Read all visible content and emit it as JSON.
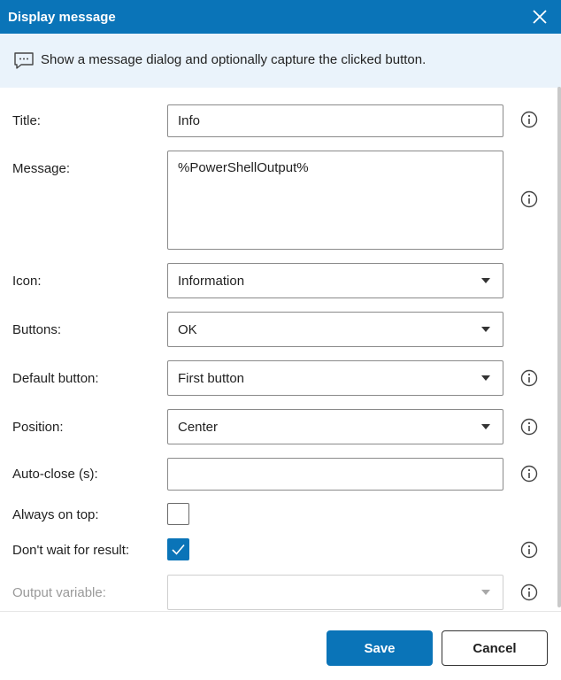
{
  "dialog": {
    "title": "Display message",
    "description": "Show a message dialog and optionally capture the clicked button."
  },
  "fields": {
    "title": {
      "label": "Title:",
      "value": "Info"
    },
    "message": {
      "label": "Message:",
      "value": "%PowerShellOutput%"
    },
    "icon": {
      "label": "Icon:",
      "value": "Information"
    },
    "buttons": {
      "label": "Buttons:",
      "value": "OK"
    },
    "default_button": {
      "label": "Default button:",
      "value": "First button"
    },
    "position": {
      "label": "Position:",
      "value": "Center"
    },
    "auto_close": {
      "label": "Auto-close (s):",
      "value": ""
    },
    "always_on_top": {
      "label": "Always on top:",
      "checked": false
    },
    "dont_wait": {
      "label": "Don't wait for result:",
      "checked": true
    },
    "output_variable": {
      "label": "Output variable:",
      "value": "",
      "disabled": true
    }
  },
  "footer": {
    "save_label": "Save",
    "cancel_label": "Cancel"
  },
  "colors": {
    "accent": "#0a74b8",
    "banner_bg": "#eaf3fb"
  },
  "icons": {
    "close": "close-icon",
    "banner": "message-icon",
    "info": "info-icon",
    "dropdown": "chevron-down-icon",
    "check": "checkmark-icon"
  }
}
